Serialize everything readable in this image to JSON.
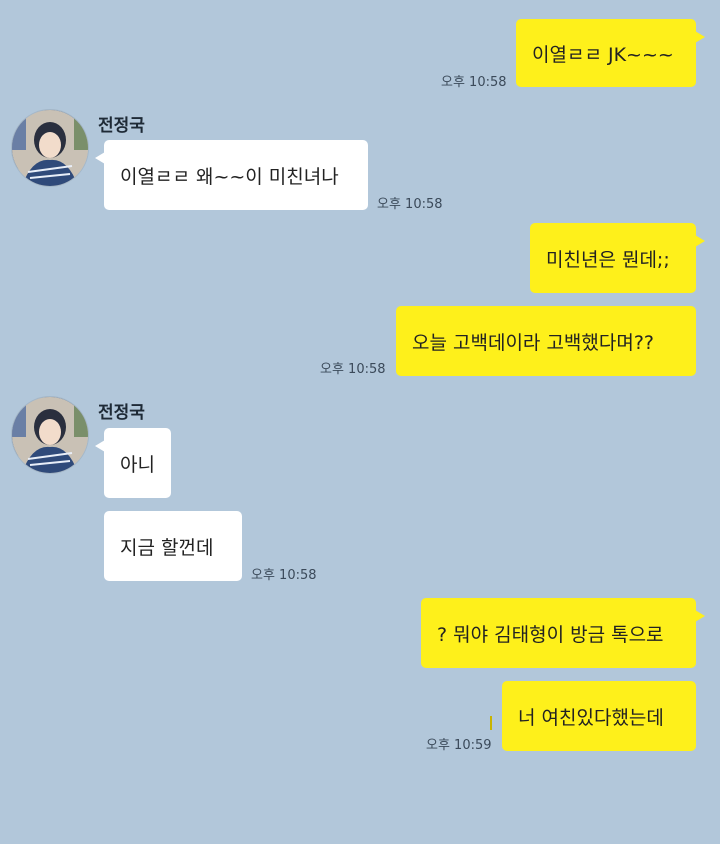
{
  "chat": {
    "contact_name": "전정국",
    "messages": [
      {
        "from": "me",
        "text": "이열ㄹㄹ JK~~~",
        "time": "오후 10:58"
      },
      {
        "from": "them",
        "text": "이열ㄹㄹ 왜~~이 미친녀나",
        "time": "오후 10:58"
      },
      {
        "from": "me",
        "text": "미친년은 뭔데;;",
        "time": ""
      },
      {
        "from": "me",
        "text": "오늘 고백데이라 고백했다며??",
        "time": "오후 10:58"
      },
      {
        "from": "them",
        "text": "아니",
        "time": ""
      },
      {
        "from": "them",
        "text": "지금 할껀데",
        "time": "오후 10:58"
      },
      {
        "from": "me",
        "text": "? 뭐야 김태형이 방금 톡으로",
        "time": ""
      },
      {
        "from": "me",
        "text": "너 여친있다했는데",
        "time": "오후 10:59"
      }
    ]
  },
  "colors": {
    "background": "#b2c7da",
    "my_bubble": "#fef01b",
    "their_bubble": "#ffffff"
  },
  "icons": {
    "avatar": "profile-photo"
  }
}
